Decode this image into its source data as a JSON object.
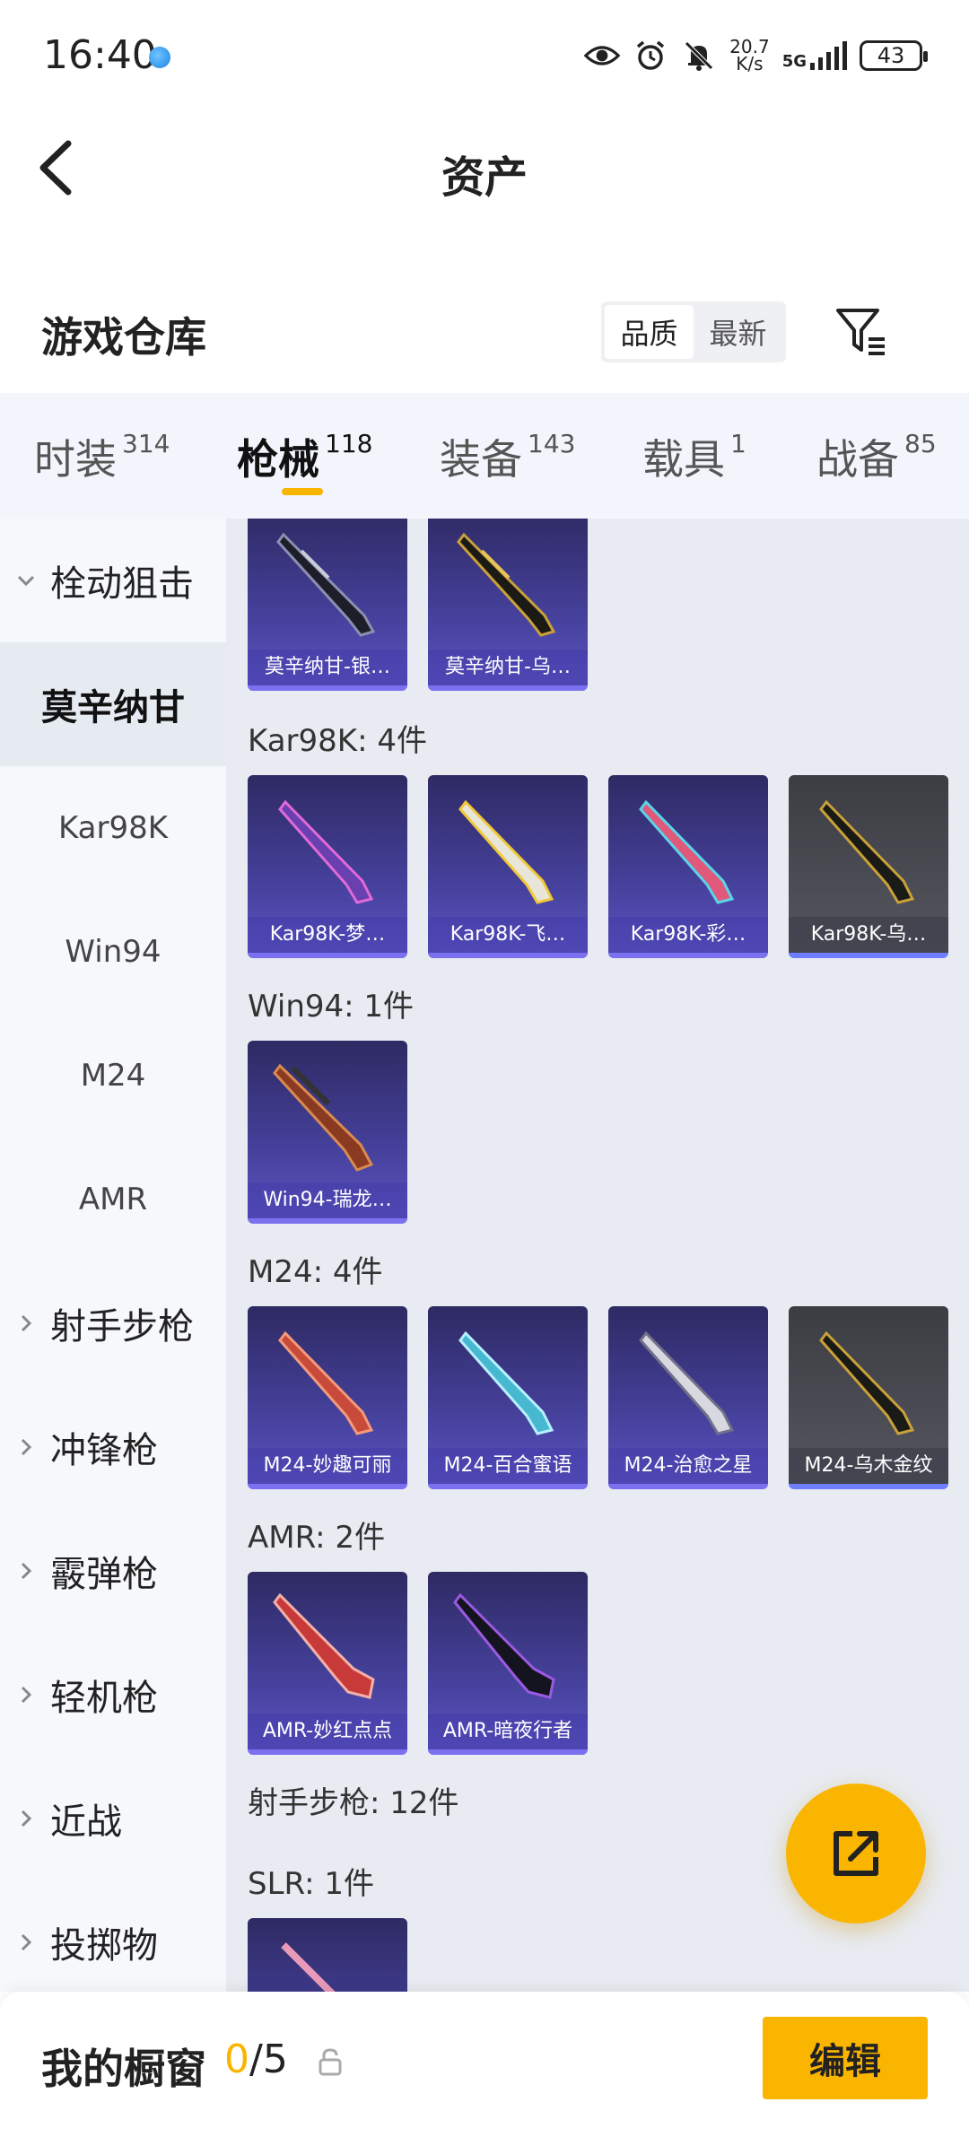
{
  "status": {
    "time": "16:40",
    "net_speed_value": "20.7",
    "net_speed_unit": "K/s",
    "network": "5G",
    "battery": "43"
  },
  "header": {
    "title": "资产"
  },
  "warehouse": {
    "title": "游戏仓库",
    "sort_options": [
      "品质",
      "最新"
    ],
    "sort_selected": "品质"
  },
  "tabs": [
    {
      "label": "时装",
      "count": "314"
    },
    {
      "label": "枪械",
      "count": "118",
      "active": true
    },
    {
      "label": "装备",
      "count": "143"
    },
    {
      "label": "载具",
      "count": "1"
    },
    {
      "label": "战备",
      "count": "85"
    }
  ],
  "sidebar": {
    "items": [
      {
        "label": "栓动狙击",
        "type": "group",
        "expanded": true
      },
      {
        "label": "莫辛纳甘",
        "type": "sub",
        "selected": true
      },
      {
        "label": "Kar98K",
        "type": "sub"
      },
      {
        "label": "Win94",
        "type": "sub"
      },
      {
        "label": "M24",
        "type": "sub"
      },
      {
        "label": "AMR",
        "type": "sub"
      },
      {
        "label": "射手步枪",
        "type": "group"
      },
      {
        "label": "冲锋枪",
        "type": "group"
      },
      {
        "label": "霰弹枪",
        "type": "group"
      },
      {
        "label": "轻机枪",
        "type": "group"
      },
      {
        "label": "近战",
        "type": "group"
      },
      {
        "label": "投掷物",
        "type": "group"
      }
    ]
  },
  "content": {
    "mosin_items": [
      {
        "name": "莫辛纳甘-银…"
      },
      {
        "name": "莫辛纳甘-乌…"
      }
    ],
    "kar98k": {
      "label": "Kar98K: 4件",
      "items": [
        {
          "name": "Kar98K-梦…"
        },
        {
          "name": "Kar98K-飞…"
        },
        {
          "name": "Kar98K-彩…"
        },
        {
          "name": "Kar98K-乌…"
        }
      ]
    },
    "win94": {
      "label": "Win94: 1件",
      "items": [
        {
          "name": "Win94-瑞龙…"
        }
      ]
    },
    "m24": {
      "label": "M24: 4件",
      "items": [
        {
          "name": "M24-妙趣可丽"
        },
        {
          "name": "M24-百合蜜语"
        },
        {
          "name": "M24-治愈之星"
        },
        {
          "name": "M24-乌木金纹"
        }
      ]
    },
    "amr": {
      "label": "AMR: 2件",
      "items": [
        {
          "name": "AMR-妙红点点"
        },
        {
          "name": "AMR-暗夜行者"
        }
      ]
    },
    "marksman_label": "射手步枪: 12件",
    "slr_label": "SLR: 1件"
  },
  "showcase": {
    "title": "我的橱窗",
    "used": "0",
    "total": "/5",
    "edit_label": "编辑"
  },
  "colors": {
    "accent": "#f9b500",
    "card_purple": "#45409a",
    "card_gray": "#55565e"
  }
}
